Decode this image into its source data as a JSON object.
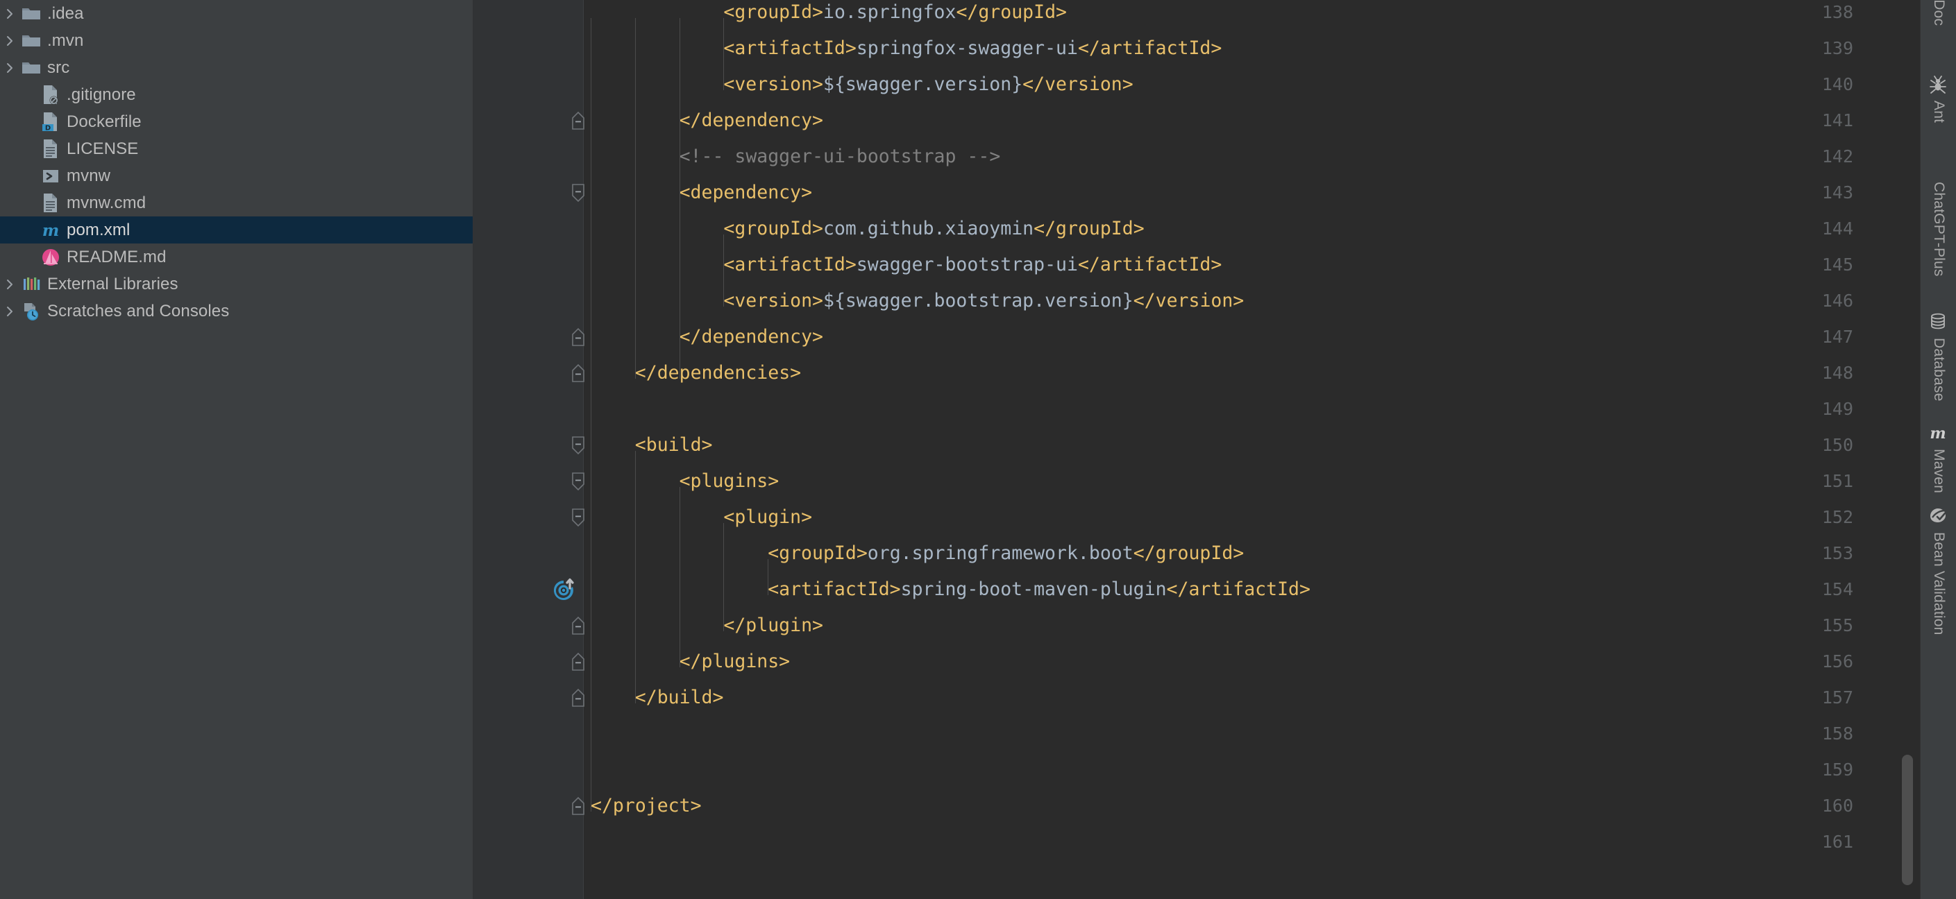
{
  "project_tree": {
    "items": [
      {
        "label": ".idea",
        "icon": "folder-icon",
        "arrow": "chevron-right-icon",
        "indent": 1,
        "selected": false
      },
      {
        "label": ".mvn",
        "icon": "folder-icon",
        "arrow": "chevron-right-icon",
        "indent": 1,
        "selected": false
      },
      {
        "label": "src",
        "icon": "folder-icon",
        "arrow": "chevron-right-icon",
        "indent": 1,
        "selected": false
      },
      {
        "label": ".gitignore",
        "icon": "gitignore-file-icon",
        "arrow": "none",
        "indent": 2,
        "selected": false
      },
      {
        "label": "Dockerfile",
        "icon": "dockerfile-icon",
        "arrow": "none",
        "indent": 2,
        "selected": false
      },
      {
        "label": "LICENSE",
        "icon": "text-file-icon",
        "arrow": "none",
        "indent": 2,
        "selected": false
      },
      {
        "label": "mvnw",
        "icon": "shell-script-icon",
        "arrow": "none",
        "indent": 2,
        "selected": false
      },
      {
        "label": "mvnw.cmd",
        "icon": "text-file-icon",
        "arrow": "none",
        "indent": 2,
        "selected": false
      },
      {
        "label": "pom.xml",
        "icon": "maven-pom-icon",
        "arrow": "none",
        "indent": 2,
        "selected": true
      },
      {
        "label": "README.md",
        "icon": "markdown-icon",
        "arrow": "none",
        "indent": 2,
        "selected": false
      },
      {
        "label": "External Libraries",
        "icon": "libraries-icon",
        "arrow": "chevron-right-icon",
        "indent": 1,
        "selected": false
      },
      {
        "label": "Scratches and Consoles",
        "icon": "scratches-icon",
        "arrow": "chevron-right-icon",
        "indent": 1,
        "selected": false
      }
    ]
  },
  "editor": {
    "file": "pom.xml",
    "first_line": 138,
    "last_line": 161,
    "lines": [
      {
        "n": 138,
        "indent": 3,
        "fold": "none",
        "runmark": false,
        "spans": [
          {
            "t": "tag",
            "s": "<groupId>"
          },
          {
            "t": "txt",
            "s": "io.springfox"
          },
          {
            "t": "tag",
            "s": "</groupId>"
          }
        ]
      },
      {
        "n": 139,
        "indent": 3,
        "fold": "none",
        "runmark": false,
        "spans": [
          {
            "t": "tag",
            "s": "<artifactId>"
          },
          {
            "t": "txt",
            "s": "springfox-swagger-ui"
          },
          {
            "t": "tag",
            "s": "</artifactId>"
          }
        ]
      },
      {
        "n": 140,
        "indent": 3,
        "fold": "none",
        "runmark": false,
        "spans": [
          {
            "t": "tag",
            "s": "<version>"
          },
          {
            "t": "txt",
            "s": "${swagger.version}"
          },
          {
            "t": "tag",
            "s": "</version>"
          }
        ]
      },
      {
        "n": 141,
        "indent": 2,
        "fold": "end",
        "runmark": false,
        "spans": [
          {
            "t": "tag",
            "s": "</dependency>"
          }
        ]
      },
      {
        "n": 142,
        "indent": 2,
        "fold": "none",
        "runmark": false,
        "spans": [
          {
            "t": "cmt",
            "s": "<!-- swagger-ui-bootstrap -->"
          }
        ]
      },
      {
        "n": 143,
        "indent": 2,
        "fold": "start",
        "runmark": false,
        "spans": [
          {
            "t": "tag",
            "s": "<dependency>"
          }
        ]
      },
      {
        "n": 144,
        "indent": 3,
        "fold": "none",
        "runmark": false,
        "spans": [
          {
            "t": "tag",
            "s": "<groupId>"
          },
          {
            "t": "txt",
            "s": "com.github.xiaoymin"
          },
          {
            "t": "tag",
            "s": "</groupId>"
          }
        ]
      },
      {
        "n": 145,
        "indent": 3,
        "fold": "none",
        "runmark": false,
        "spans": [
          {
            "t": "tag",
            "s": "<artifactId>"
          },
          {
            "t": "txt",
            "s": "swagger-bootstrap-ui"
          },
          {
            "t": "tag",
            "s": "</artifactId>"
          }
        ]
      },
      {
        "n": 146,
        "indent": 3,
        "fold": "none",
        "runmark": false,
        "spans": [
          {
            "t": "tag",
            "s": "<version>"
          },
          {
            "t": "txt",
            "s": "${swagger.bootstrap.version}"
          },
          {
            "t": "tag",
            "s": "</version>"
          }
        ]
      },
      {
        "n": 147,
        "indent": 2,
        "fold": "end",
        "runmark": false,
        "spans": [
          {
            "t": "tag",
            "s": "</dependency>"
          }
        ]
      },
      {
        "n": 148,
        "indent": 1,
        "fold": "end",
        "runmark": false,
        "spans": [
          {
            "t": "tag",
            "s": "</dependencies>"
          }
        ]
      },
      {
        "n": 149,
        "indent": 0,
        "fold": "none",
        "runmark": false,
        "spans": []
      },
      {
        "n": 150,
        "indent": 1,
        "fold": "start",
        "runmark": false,
        "spans": [
          {
            "t": "tag",
            "s": "<build>"
          }
        ]
      },
      {
        "n": 151,
        "indent": 2,
        "fold": "start",
        "runmark": false,
        "spans": [
          {
            "t": "tag",
            "s": "<plugins>"
          }
        ]
      },
      {
        "n": 152,
        "indent": 3,
        "fold": "start",
        "runmark": false,
        "spans": [
          {
            "t": "tag",
            "s": "<plugin>"
          }
        ]
      },
      {
        "n": 153,
        "indent": 4,
        "fold": "none",
        "runmark": false,
        "spans": [
          {
            "t": "tag",
            "s": "<groupId>"
          },
          {
            "t": "txt",
            "s": "org.springframework.boot"
          },
          {
            "t": "tag",
            "s": "</groupId>"
          }
        ]
      },
      {
        "n": 154,
        "indent": 4,
        "fold": "none",
        "runmark": true,
        "spans": [
          {
            "t": "tag",
            "s": "<artifactId>"
          },
          {
            "t": "txt",
            "s": "spring-boot-maven-plugin"
          },
          {
            "t": "tag",
            "s": "</artifactId>"
          }
        ]
      },
      {
        "n": 155,
        "indent": 3,
        "fold": "end",
        "runmark": false,
        "spans": [
          {
            "t": "tag",
            "s": "</plugin>"
          }
        ]
      },
      {
        "n": 156,
        "indent": 2,
        "fold": "end",
        "runmark": false,
        "spans": [
          {
            "t": "tag",
            "s": "</plugins>"
          }
        ]
      },
      {
        "n": 157,
        "indent": 1,
        "fold": "end",
        "runmark": false,
        "spans": [
          {
            "t": "tag",
            "s": "</build>"
          }
        ]
      },
      {
        "n": 158,
        "indent": 0,
        "fold": "none",
        "runmark": false,
        "spans": []
      },
      {
        "n": 159,
        "indent": 0,
        "fold": "none",
        "runmark": false,
        "spans": []
      },
      {
        "n": 160,
        "indent": 0,
        "fold": "end",
        "runmark": false,
        "spans": [
          {
            "t": "tag",
            "s": "</project>"
          }
        ]
      },
      {
        "n": 161,
        "indent": 0,
        "fold": "none",
        "runmark": false,
        "spans": []
      }
    ]
  },
  "right_stripe": {
    "tabs": [
      {
        "label": "wnDoc",
        "icon": "none",
        "clipped": true
      },
      {
        "label": "Ant",
        "icon": "ant-icon",
        "clipped": false
      },
      {
        "label": "ChatGPT-Plus",
        "icon": "none",
        "clipped": false
      },
      {
        "label": "Database",
        "icon": "database-icon",
        "clipped": false
      },
      {
        "label": "Maven",
        "icon": "maven-icon",
        "clipped": false
      },
      {
        "label": "Bean Validation",
        "icon": "bean-validation-icon",
        "clipped": false
      }
    ]
  },
  "colors": {
    "editor_bg": "#2b2b2b",
    "panel_bg": "#3c3f41",
    "gutter_bg": "#313335",
    "selection_bg": "#0d293f",
    "xml_tag": "#e8bf6a",
    "xml_text": "#a9b7c6",
    "comment": "#808080",
    "line_number": "#606366",
    "tree_text": "#bbbbbb",
    "accent_blue": "#3592c4",
    "markdown_pink": "#e0478a"
  }
}
